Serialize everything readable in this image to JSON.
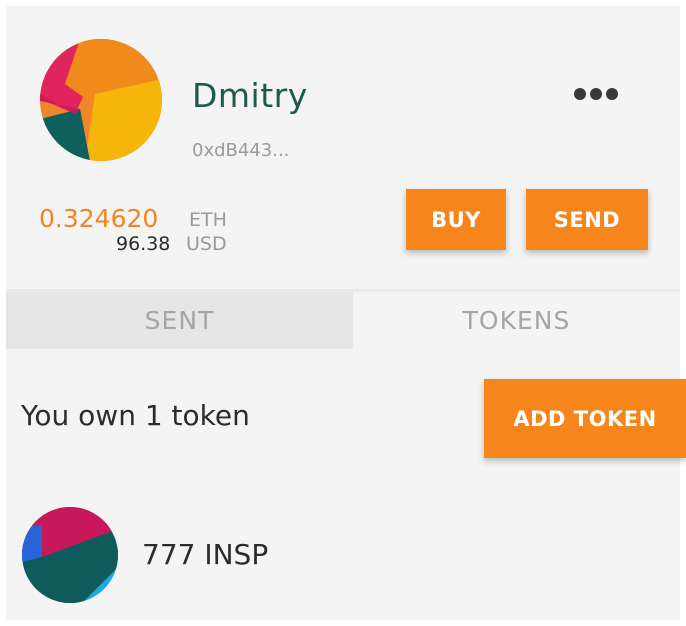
{
  "account": {
    "name": "Dmitry",
    "address": "0xdB443...",
    "menu_icon": "ellipsis-icon"
  },
  "balance": {
    "eth_amount": "0.324620",
    "eth_unit": "ETH",
    "usd_amount": "96.38",
    "usd_unit": "USD"
  },
  "actions": {
    "buy_label": "BUY",
    "send_label": "SEND"
  },
  "tabs": [
    {
      "label": "SENT",
      "active": false
    },
    {
      "label": "TOKENS",
      "active": true
    }
  ],
  "tokens": {
    "count_text": "You own 1 token",
    "add_label": "ADD TOKEN",
    "items": [
      {
        "label": "777 INSP",
        "icon": "token-identicon"
      }
    ]
  },
  "colors": {
    "accent": "#f6851b",
    "name_text": "#1f5a4e",
    "eth_text": "#f5841f",
    "muted": "#9a9a9a"
  }
}
